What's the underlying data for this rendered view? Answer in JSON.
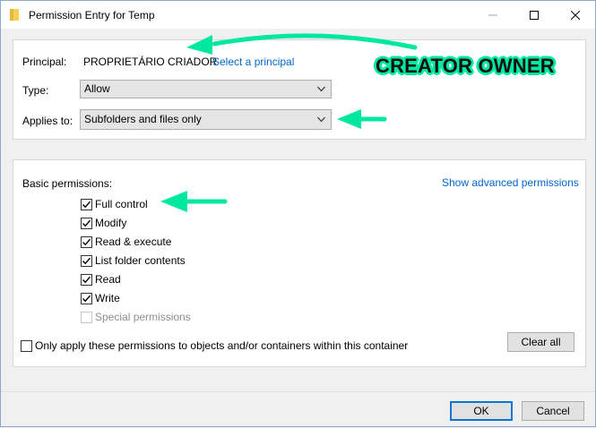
{
  "window": {
    "title": "Permission Entry for Temp",
    "icon": "folder-icon",
    "controls": [
      "minimize",
      "maximize",
      "close"
    ]
  },
  "principal": {
    "label": "Principal:",
    "value": "PROPRIETÁRIO CRIADOR",
    "link": "Select a principal"
  },
  "type": {
    "label": "Type:",
    "value": "Allow"
  },
  "applies_to": {
    "label": "Applies to:",
    "value": "Subfolders and files only"
  },
  "permissions": {
    "heading": "Basic permissions:",
    "advanced_link": "Show advanced permissions",
    "items": [
      {
        "label": "Full control",
        "checked": true,
        "disabled": false
      },
      {
        "label": "Modify",
        "checked": true,
        "disabled": false
      },
      {
        "label": "Read & execute",
        "checked": true,
        "disabled": false
      },
      {
        "label": "List folder contents",
        "checked": true,
        "disabled": false
      },
      {
        "label": "Read",
        "checked": true,
        "disabled": false
      },
      {
        "label": "Write",
        "checked": true,
        "disabled": false
      },
      {
        "label": "Special permissions",
        "checked": false,
        "disabled": true
      }
    ],
    "only_apply": {
      "label": "Only apply these permissions to objects and/or containers within this container",
      "checked": false
    },
    "clear_all": "Clear all"
  },
  "footer": {
    "ok": "OK",
    "cancel": "Cancel"
  },
  "annotation": {
    "text": "CREATOR OWNER",
    "color": "#00e8a0"
  }
}
